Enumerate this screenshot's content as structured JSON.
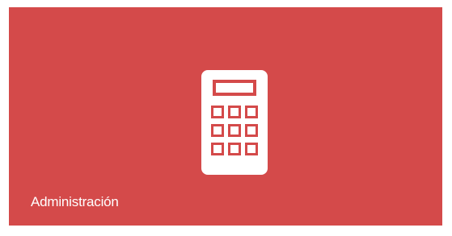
{
  "tile": {
    "label": "Administración",
    "icon": "calculator-icon",
    "background_color": "#d44a4a",
    "foreground_color": "#ffffff"
  }
}
